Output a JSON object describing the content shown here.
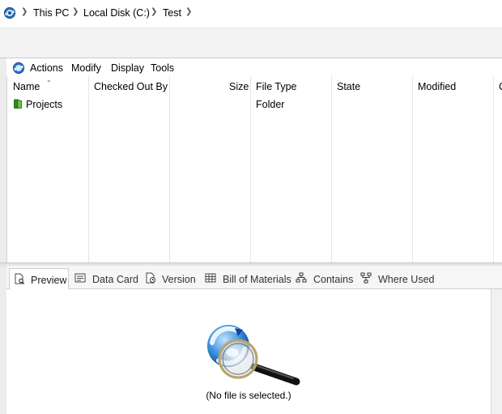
{
  "address": {
    "crumbs": [
      "This PC",
      "Local Disk (C:)",
      "Test"
    ]
  },
  "menu": {
    "items": [
      "Actions",
      "Modify",
      "Display",
      "Tools"
    ]
  },
  "list": {
    "columns": [
      "Name",
      "Checked Out By",
      "Size",
      "File Type",
      "State",
      "Modified",
      "C"
    ],
    "rows": [
      {
        "name": "Projects",
        "checked_out_by": "",
        "size": "",
        "file_type": "Folder",
        "state": "",
        "modified": ""
      }
    ]
  },
  "tabs": {
    "items": [
      "Preview",
      "Data Card",
      "Version",
      "Bill of Materials",
      "Contains",
      "Where Used"
    ],
    "active": "Preview"
  },
  "preview": {
    "message": "(No file is selected.)"
  },
  "colors": {
    "folder": "#3a9a2a",
    "accent": "#1f6fc5"
  }
}
